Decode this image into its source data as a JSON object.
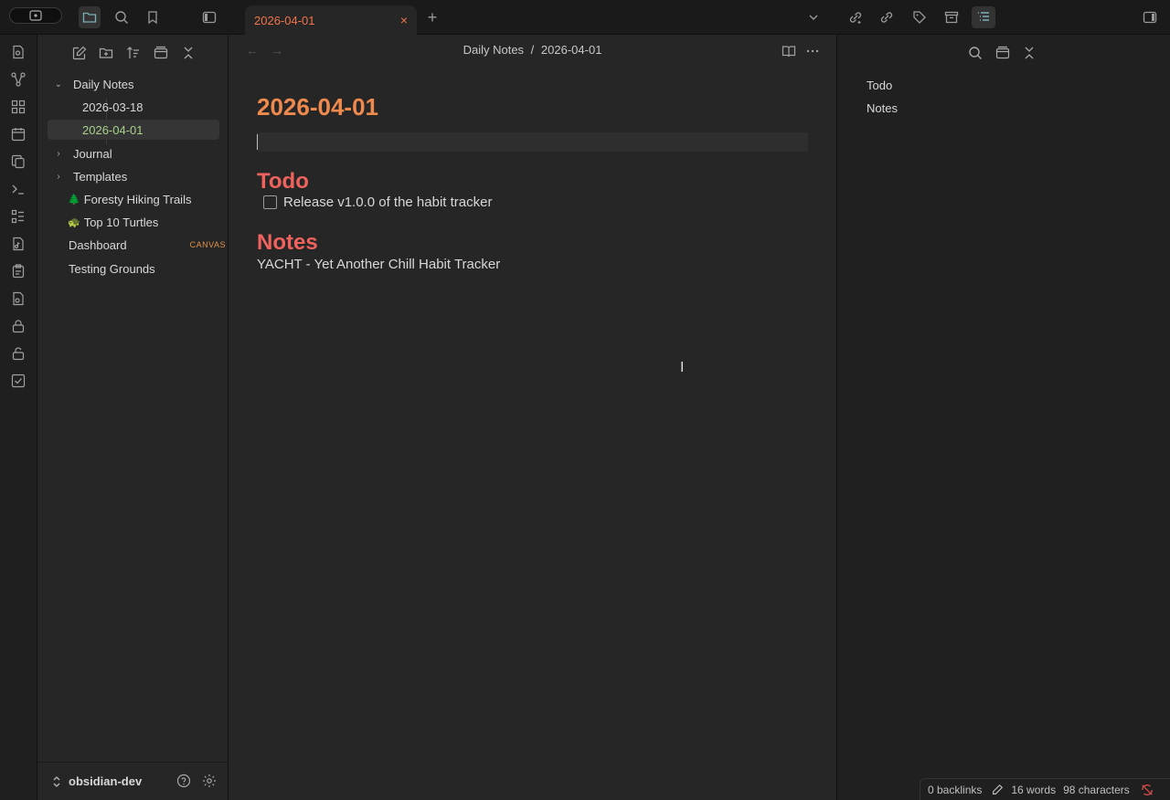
{
  "tab": {
    "title": "2026-04-01",
    "close": "×",
    "new": "+"
  },
  "breadcrumb": {
    "folder": "Daily Notes",
    "sep": "/",
    "file": "2026-04-01"
  },
  "sidebar": {
    "vault_name": "obsidian-dev",
    "tree": [
      {
        "label": "Daily Notes",
        "chevron": "⌄"
      },
      {
        "label": "2026-03-18"
      },
      {
        "label": "2026-04-01"
      },
      {
        "label": "Journal",
        "chevron": "›"
      },
      {
        "label": "Templates",
        "chevron": "›"
      },
      {
        "label": "Foresty Hiking Trails",
        "emoji": "🌲"
      },
      {
        "label": "Top 10 Turtles",
        "emoji": "🐢"
      },
      {
        "label": "Dashboard",
        "tag": "CANVAS"
      },
      {
        "label": "Testing Grounds"
      }
    ]
  },
  "note": {
    "title": "2026-04-01",
    "heading_todo": "Todo",
    "task_text": "Release v1.0.0 of the habit tracker",
    "heading_notes": "Notes",
    "body": "YACHT - Yet Another Chill Habit Tracker"
  },
  "outline": {
    "items": [
      "Todo",
      "Notes"
    ]
  },
  "status": {
    "backlinks": "0 backlinks",
    "words": "16 words",
    "chars": "98 characters"
  },
  "icons": {
    "titlebar": [
      "vault-switcher-icon",
      "folder-icon",
      "search-icon",
      "bookmark-icon",
      "sidebar-toggle-icon",
      "chevron-down-icon",
      "link-plus-icon",
      "link-icon",
      "tag-icon",
      "archive-icon",
      "outline-icon",
      "right-sidebar-toggle-icon"
    ],
    "ribbon": [
      "file-search-icon",
      "graph-icon",
      "canvas-icon",
      "calendar-icon",
      "copy-icon",
      "terminal-icon",
      "list-icon",
      "file-music-icon",
      "clipboard-icon",
      "file-audio-icon",
      "lock-icon",
      "unlock-icon",
      "checkbox-icon"
    ]
  },
  "colors": {
    "accent": "#f0744a",
    "h1": "#ef8a4e",
    "h2": "#f0625e",
    "selected": "#a8d18d"
  }
}
